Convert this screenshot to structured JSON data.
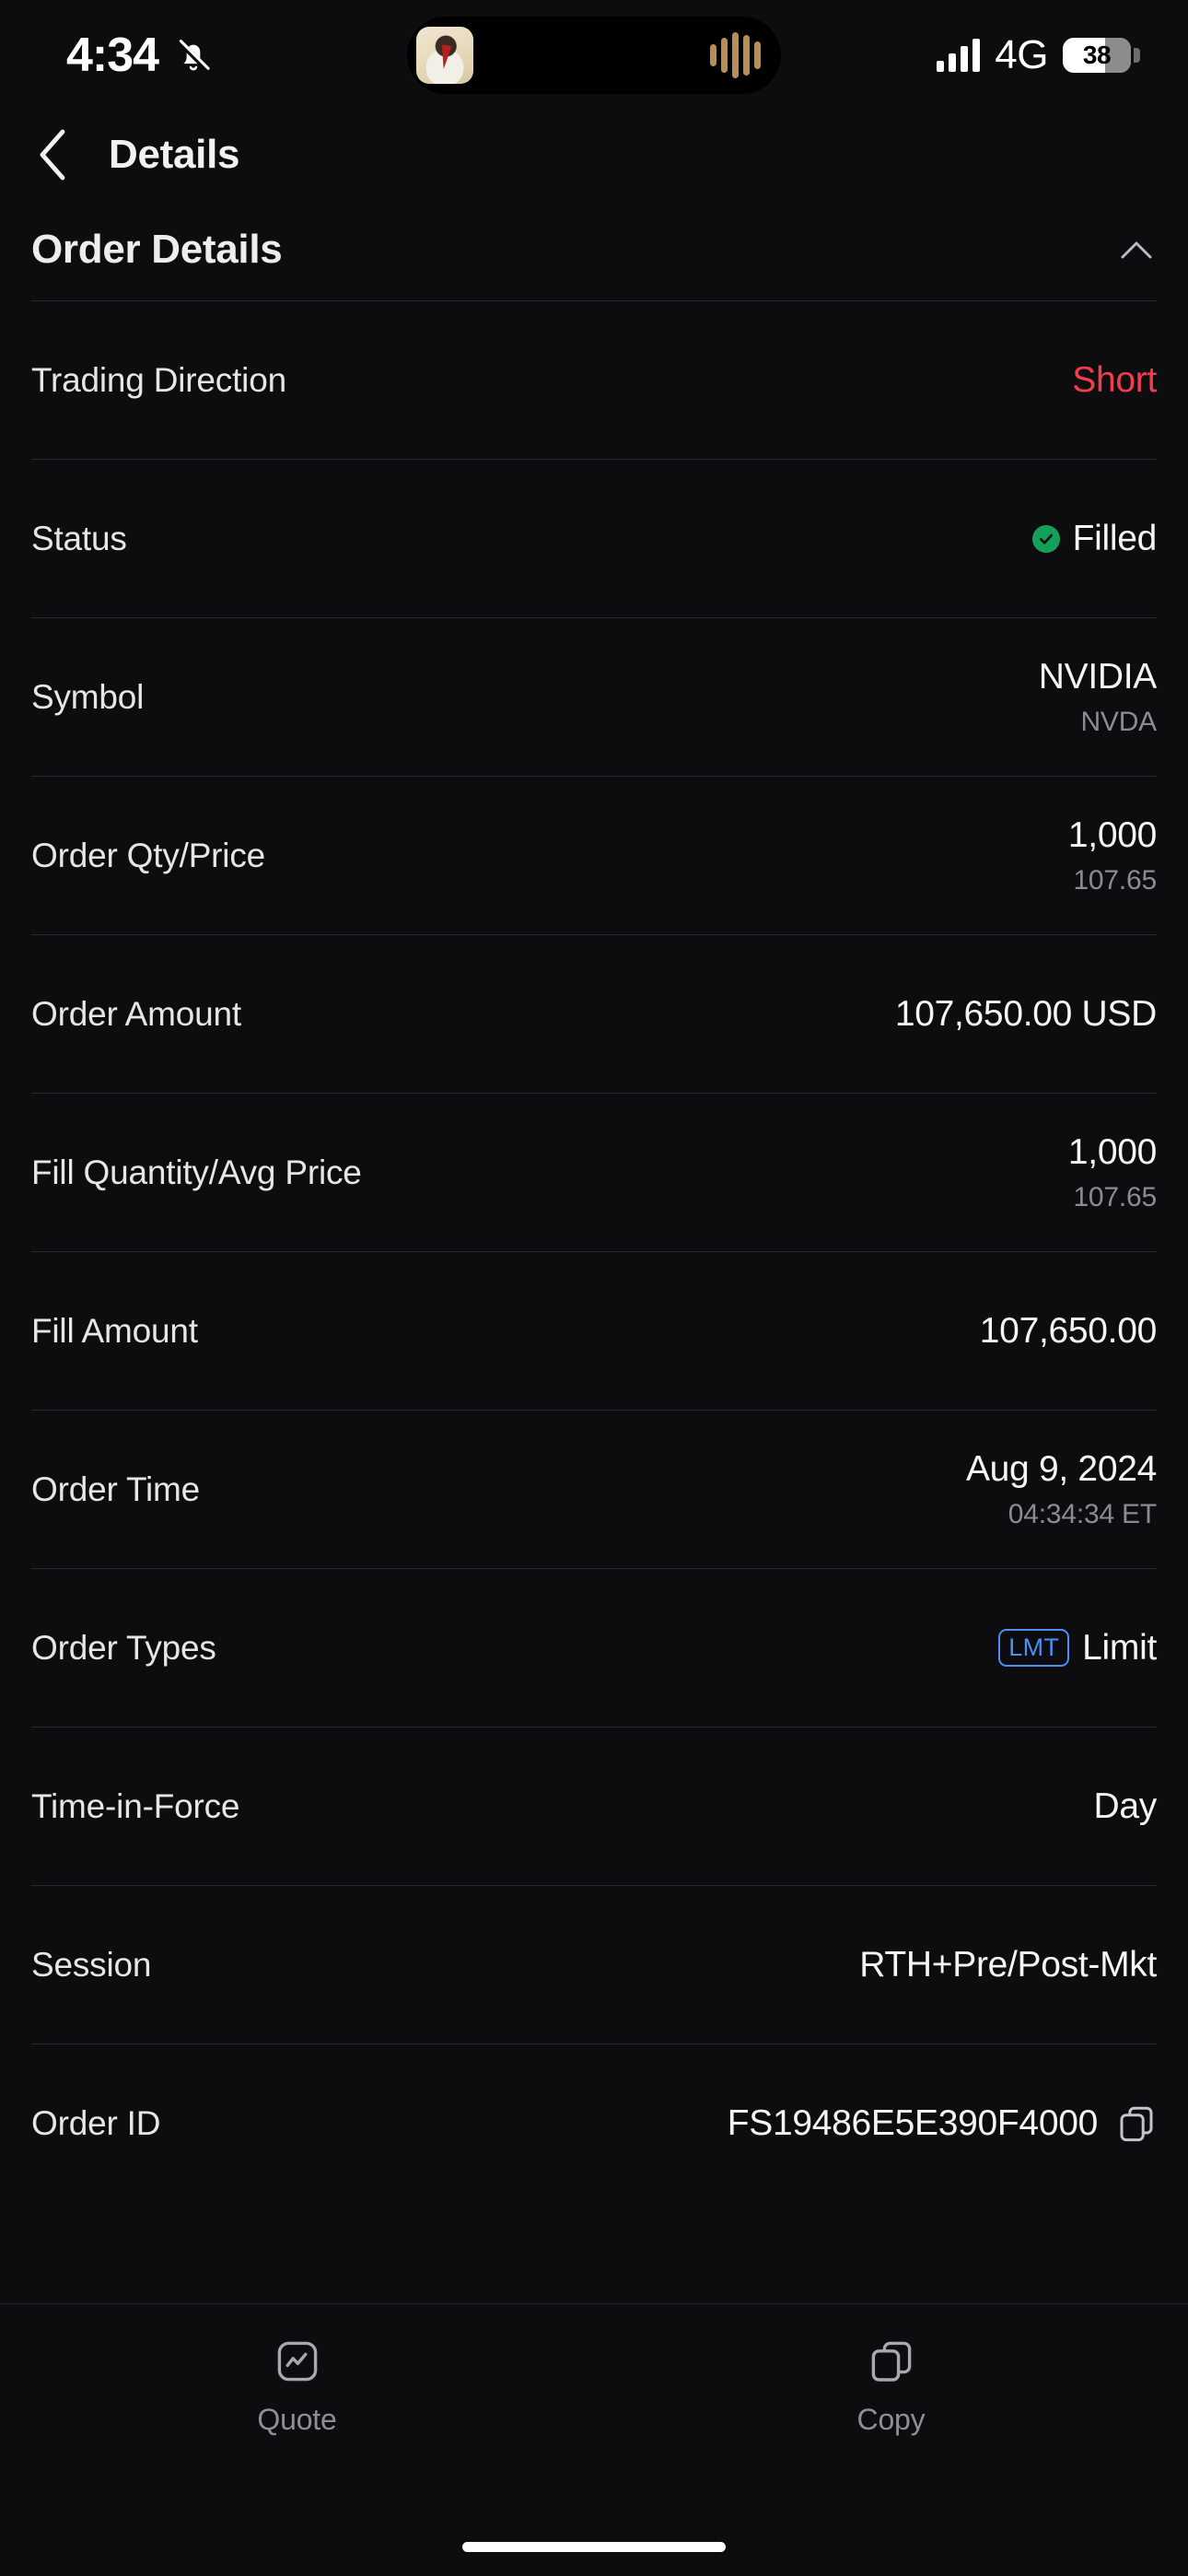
{
  "status_bar": {
    "time": "4:34",
    "mute_icon": "bell-slash-icon",
    "network": "4G",
    "battery_percent": "38",
    "dynamic_island": {
      "album_art": "album-art-thumbnail",
      "audio_waveform": "audio-waveform-icon"
    }
  },
  "nav": {
    "back_icon": "chevron-left-icon",
    "title": "Details"
  },
  "section": {
    "title": "Order Details",
    "collapse_icon": "chevron-up-icon"
  },
  "rows": [
    {
      "label": "Trading Direction",
      "value": "Short",
      "style": "short"
    },
    {
      "label": "Status",
      "value": "Filled",
      "icon": "check-circle-icon"
    },
    {
      "label": "Symbol",
      "value": "NVIDIA",
      "subvalue": "NVDA"
    },
    {
      "label": "Order Qty/Price",
      "value": "1,000",
      "subvalue": "107.65"
    },
    {
      "label": "Order Amount",
      "value": "107,650.00 USD"
    },
    {
      "label": "Fill Quantity/Avg Price",
      "value": "1,000",
      "subvalue": "107.65"
    },
    {
      "label": "Fill Amount",
      "value": "107,650.00"
    },
    {
      "label": "Order Time",
      "value": "Aug 9, 2024",
      "subvalue": "04:34:34 ET"
    },
    {
      "label": "Order Types",
      "badge": "LMT",
      "value": "Limit"
    },
    {
      "label": "Time-in-Force",
      "value": "Day"
    },
    {
      "label": "Session",
      "value": "RTH+Pre/Post-Mkt"
    },
    {
      "label": "Order ID",
      "value": "FS19486E5E390F4000",
      "trailing_icon": "copy-icon"
    }
  ],
  "bottom_bar": {
    "items": [
      {
        "label": "Quote",
        "icon": "chart-square-icon"
      },
      {
        "label": "Copy",
        "icon": "copy-icon"
      }
    ]
  },
  "colors": {
    "background": "#0d0d0f",
    "short_red": "#f33d4e",
    "filled_green": "#13a05a",
    "badge_blue": "#4b8ef5",
    "divider": "#26272a",
    "secondary_text": "#8a8c90"
  }
}
